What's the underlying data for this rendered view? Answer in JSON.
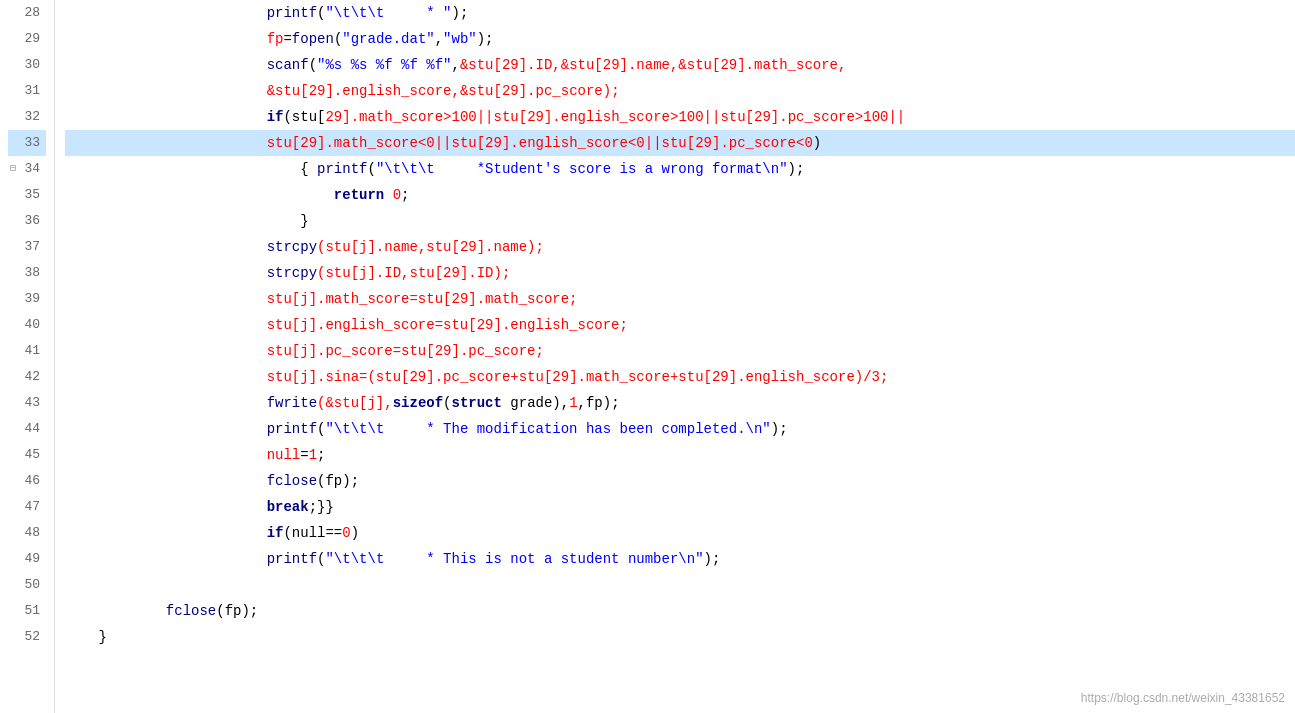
{
  "lines": [
    {
      "num": 28,
      "highlighted": false,
      "fold": false,
      "tokens": [
        {
          "t": "\t\t\t\t\t\t",
          "c": "normal"
        },
        {
          "t": "printf",
          "c": "fn"
        },
        {
          "t": "(",
          "c": "normal"
        },
        {
          "t": "\"\\t\\t\\t\t * \"",
          "c": "str"
        },
        {
          "t": ");",
          "c": "normal"
        }
      ]
    },
    {
      "num": 29,
      "highlighted": false,
      "fold": false,
      "tokens": [
        {
          "t": "\t\t\t\t\t\t",
          "c": "normal"
        },
        {
          "t": "fp",
          "c": "red"
        },
        {
          "t": "=",
          "c": "normal"
        },
        {
          "t": "fopen",
          "c": "fn"
        },
        {
          "t": "(",
          "c": "normal"
        },
        {
          "t": "\"grade.dat\"",
          "c": "str"
        },
        {
          "t": ",",
          "c": "normal"
        },
        {
          "t": "\"wb\"",
          "c": "str"
        },
        {
          "t": ");",
          "c": "normal"
        }
      ]
    },
    {
      "num": 30,
      "highlighted": false,
      "fold": false,
      "tokens": [
        {
          "t": "\t\t\t\t\t\t",
          "c": "normal"
        },
        {
          "t": "scanf",
          "c": "fn"
        },
        {
          "t": "(",
          "c": "normal"
        },
        {
          "t": "\"%s %s %f %f %f\"",
          "c": "str"
        },
        {
          "t": ",",
          "c": "normal"
        },
        {
          "t": "&stu[",
          "c": "red"
        },
        {
          "t": "29",
          "c": "num"
        },
        {
          "t": "].ID,&stu[",
          "c": "red"
        },
        {
          "t": "29",
          "c": "num"
        },
        {
          "t": "].name,&stu[",
          "c": "red"
        },
        {
          "t": "29",
          "c": "num"
        },
        {
          "t": "].math_score,",
          "c": "red"
        }
      ]
    },
    {
      "num": 31,
      "highlighted": false,
      "fold": false,
      "tokens": [
        {
          "t": "\t\t\t\t\t\t",
          "c": "normal"
        },
        {
          "t": "&stu[",
          "c": "red"
        },
        {
          "t": "29",
          "c": "num"
        },
        {
          "t": "].english_score,&stu[",
          "c": "red"
        },
        {
          "t": "29",
          "c": "num"
        },
        {
          "t": "].pc_score);",
          "c": "red"
        }
      ]
    },
    {
      "num": 32,
      "highlighted": false,
      "fold": false,
      "tokens": [
        {
          "t": "\t\t\t\t\t\t",
          "c": "normal"
        },
        {
          "t": "if",
          "c": "bold-kw"
        },
        {
          "t": "(stu[",
          "c": "normal"
        },
        {
          "t": "29",
          "c": "num"
        },
        {
          "t": "].math_score>",
          "c": "red"
        },
        {
          "t": "100",
          "c": "num"
        },
        {
          "t": "||stu[",
          "c": "red"
        },
        {
          "t": "29",
          "c": "num"
        },
        {
          "t": "].english_score>",
          "c": "red"
        },
        {
          "t": "100",
          "c": "num"
        },
        {
          "t": "||stu[",
          "c": "red"
        },
        {
          "t": "29",
          "c": "num"
        },
        {
          "t": "].pc_score>",
          "c": "red"
        },
        {
          "t": "100",
          "c": "num"
        },
        {
          "t": "||",
          "c": "red"
        }
      ]
    },
    {
      "num": 33,
      "highlighted": true,
      "fold": false,
      "tokens": [
        {
          "t": "\t\t\t\t\t\t",
          "c": "normal"
        },
        {
          "t": "stu[",
          "c": "red"
        },
        {
          "t": "29",
          "c": "num"
        },
        {
          "t": "].math_score<",
          "c": "red"
        },
        {
          "t": "0",
          "c": "num"
        },
        {
          "t": "||stu[",
          "c": "red"
        },
        {
          "t": "29",
          "c": "num"
        },
        {
          "t": "].english_score<",
          "c": "red"
        },
        {
          "t": "0",
          "c": "num"
        },
        {
          "t": "||stu[",
          "c": "red"
        },
        {
          "t": "29",
          "c": "num"
        },
        {
          "t": "].pc_score<",
          "c": "red"
        },
        {
          "t": "0",
          "c": "num"
        },
        {
          "t": ")",
          "c": "normal"
        }
      ]
    },
    {
      "num": 34,
      "highlighted": false,
      "fold": true,
      "tokens": [
        {
          "t": "\t\t\t\t\t\t\t",
          "c": "normal"
        },
        {
          "t": "{ ",
          "c": "normal"
        },
        {
          "t": "printf",
          "c": "fn"
        },
        {
          "t": "(",
          "c": "normal"
        },
        {
          "t": "\"\\t\\t\\t\t *Student's score is a wrong format\\n\"",
          "c": "str"
        },
        {
          "t": ");",
          "c": "normal"
        }
      ]
    },
    {
      "num": 35,
      "highlighted": false,
      "fold": false,
      "tokens": [
        {
          "t": "\t\t\t\t\t\t\t\t",
          "c": "normal"
        },
        {
          "t": "return ",
          "c": "bold-kw"
        },
        {
          "t": "0",
          "c": "num"
        },
        {
          "t": ";",
          "c": "normal"
        }
      ]
    },
    {
      "num": 36,
      "highlighted": false,
      "fold": false,
      "tokens": [
        {
          "t": "\t\t\t\t\t\t\t",
          "c": "normal"
        },
        {
          "t": "}",
          "c": "normal"
        }
      ]
    },
    {
      "num": 37,
      "highlighted": false,
      "fold": false,
      "tokens": [
        {
          "t": "\t\t\t\t\t\t",
          "c": "normal"
        },
        {
          "t": "strcpy",
          "c": "fn"
        },
        {
          "t": "(stu[j].name,stu[",
          "c": "red"
        },
        {
          "t": "29",
          "c": "num"
        },
        {
          "t": "].name);",
          "c": "red"
        }
      ]
    },
    {
      "num": 38,
      "highlighted": false,
      "fold": false,
      "tokens": [
        {
          "t": "\t\t\t\t\t\t",
          "c": "normal"
        },
        {
          "t": "strcpy",
          "c": "fn"
        },
        {
          "t": "(stu[j].ID,stu[",
          "c": "red"
        },
        {
          "t": "29",
          "c": "num"
        },
        {
          "t": "].ID);",
          "c": "red"
        }
      ]
    },
    {
      "num": 39,
      "highlighted": false,
      "fold": false,
      "tokens": [
        {
          "t": "\t\t\t\t\t\t",
          "c": "normal"
        },
        {
          "t": "stu[j].math_score=stu[",
          "c": "red"
        },
        {
          "t": "29",
          "c": "num"
        },
        {
          "t": "].math_score;",
          "c": "red"
        }
      ]
    },
    {
      "num": 40,
      "highlighted": false,
      "fold": false,
      "tokens": [
        {
          "t": "\t\t\t\t\t\t",
          "c": "normal"
        },
        {
          "t": "stu[j].english_score=stu[",
          "c": "red"
        },
        {
          "t": "29",
          "c": "num"
        },
        {
          "t": "].english_score;",
          "c": "red"
        }
      ]
    },
    {
      "num": 41,
      "highlighted": false,
      "fold": false,
      "tokens": [
        {
          "t": "\t\t\t\t\t\t",
          "c": "normal"
        },
        {
          "t": "stu[j].pc_score=stu[",
          "c": "red"
        },
        {
          "t": "29",
          "c": "num"
        },
        {
          "t": "].pc_score;",
          "c": "red"
        }
      ]
    },
    {
      "num": 42,
      "highlighted": false,
      "fold": false,
      "tokens": [
        {
          "t": "\t\t\t\t\t\t",
          "c": "normal"
        },
        {
          "t": "stu[j].sina=(stu[",
          "c": "red"
        },
        {
          "t": "29",
          "c": "num"
        },
        {
          "t": "].pc_score+stu[",
          "c": "red"
        },
        {
          "t": "29",
          "c": "num"
        },
        {
          "t": "].math_score+stu[",
          "c": "red"
        },
        {
          "t": "29",
          "c": "num"
        },
        {
          "t": "].english_score)/",
          "c": "red"
        },
        {
          "t": "3",
          "c": "num"
        },
        {
          "t": ";",
          "c": "red"
        }
      ]
    },
    {
      "num": 43,
      "highlighted": false,
      "fold": false,
      "tokens": [
        {
          "t": "\t\t\t\t\t\t",
          "c": "normal"
        },
        {
          "t": "fwrite",
          "c": "fn"
        },
        {
          "t": "(&stu[j],",
          "c": "red"
        },
        {
          "t": "sizeof",
          "c": "bold-kw"
        },
        {
          "t": "(",
          "c": "normal"
        },
        {
          "t": "struct ",
          "c": "bold-kw"
        },
        {
          "t": "grade),",
          "c": "normal"
        },
        {
          "t": "1",
          "c": "num"
        },
        {
          "t": ",fp);",
          "c": "normal"
        }
      ]
    },
    {
      "num": 44,
      "highlighted": false,
      "fold": false,
      "tokens": [
        {
          "t": "\t\t\t\t\t\t",
          "c": "normal"
        },
        {
          "t": "printf",
          "c": "fn"
        },
        {
          "t": "(",
          "c": "normal"
        },
        {
          "t": "\"\\t\\t\\t\t * The modification has been completed.\\n\"",
          "c": "str"
        },
        {
          "t": ");",
          "c": "normal"
        }
      ]
    },
    {
      "num": 45,
      "highlighted": false,
      "fold": false,
      "tokens": [
        {
          "t": "\t\t\t\t\t\t",
          "c": "normal"
        },
        {
          "t": "null",
          "c": "red"
        },
        {
          "t": "=",
          "c": "normal"
        },
        {
          "t": "1",
          "c": "num"
        },
        {
          "t": ";",
          "c": "normal"
        }
      ]
    },
    {
      "num": 46,
      "highlighted": false,
      "fold": false,
      "tokens": [
        {
          "t": "\t\t\t\t\t\t",
          "c": "normal"
        },
        {
          "t": "fclose",
          "c": "fn"
        },
        {
          "t": "(fp);",
          "c": "normal"
        }
      ]
    },
    {
      "num": 47,
      "highlighted": false,
      "fold": false,
      "tokens": [
        {
          "t": "\t\t\t\t\t\t",
          "c": "normal"
        },
        {
          "t": "break",
          "c": "bold-kw"
        },
        {
          "t": ";}}",
          "c": "normal"
        }
      ]
    },
    {
      "num": 48,
      "highlighted": false,
      "fold": false,
      "tokens": [
        {
          "t": "\t\t\t\t\t\t",
          "c": "normal"
        },
        {
          "t": "if",
          "c": "bold-kw"
        },
        {
          "t": "(null==",
          "c": "normal"
        },
        {
          "t": "0",
          "c": "num"
        },
        {
          "t": ")",
          "c": "normal"
        }
      ]
    },
    {
      "num": 49,
      "highlighted": false,
      "fold": false,
      "tokens": [
        {
          "t": "\t\t\t\t\t\t",
          "c": "normal"
        },
        {
          "t": "printf",
          "c": "fn"
        },
        {
          "t": "(",
          "c": "normal"
        },
        {
          "t": "\"\\t\\t\\t\t * This is not a student number\\n\"",
          "c": "str"
        },
        {
          "t": ");",
          "c": "normal"
        }
      ]
    },
    {
      "num": 50,
      "highlighted": false,
      "fold": false,
      "tokens": []
    },
    {
      "num": 51,
      "highlighted": false,
      "fold": false,
      "tokens": [
        {
          "t": "\t\t\t",
          "c": "normal"
        },
        {
          "t": "fclose",
          "c": "fn"
        },
        {
          "t": "(fp);",
          "c": "normal"
        }
      ]
    },
    {
      "num": 52,
      "highlighted": false,
      "fold": false,
      "tokens": [
        {
          "t": "\t",
          "c": "normal"
        },
        {
          "t": "}",
          "c": "normal"
        }
      ]
    }
  ],
  "watermark": "https://blog.csdn.net/weixin_43381652"
}
